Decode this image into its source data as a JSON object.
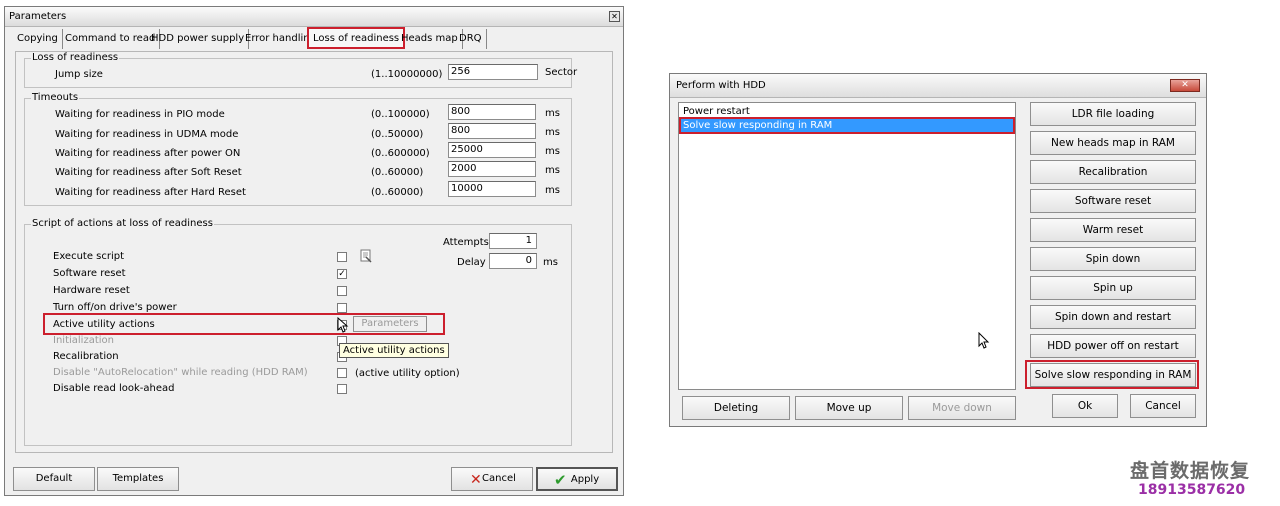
{
  "params_window": {
    "title": "Parameters",
    "tabs": [
      "Copying",
      "Command to read",
      "HDD power supply",
      "Error handling",
      "Loss of readiness",
      "Heads map",
      "DRQ"
    ],
    "active_tab": "Loss of readiness",
    "loss_group": {
      "label": "Loss of readiness",
      "jump_label": "Jump size",
      "jump_range": "(1..10000000)",
      "jump_value": "256",
      "jump_unit": "Sector"
    },
    "timeouts_group": {
      "label": "Timeouts",
      "rows": [
        {
          "label": "Waiting for readiness in PIO mode",
          "range": "(0..100000)",
          "value": "800",
          "unit": "ms"
        },
        {
          "label": "Waiting for readiness in UDMA mode",
          "range": "(0..50000)",
          "value": "800",
          "unit": "ms"
        },
        {
          "label": "Waiting for readiness after power ON",
          "range": "(0..600000)",
          "value": "25000",
          "unit": "ms"
        },
        {
          "label": "Waiting for readiness after Soft Reset",
          "range": "(0..60000)",
          "value": "2000",
          "unit": "ms"
        },
        {
          "label": "Waiting for readiness after Hard Reset",
          "range": "(0..60000)",
          "value": "10000",
          "unit": "ms"
        }
      ]
    },
    "script_group": {
      "label": "Script of actions at loss of readiness",
      "attempts_label": "Attempts",
      "attempts_value": "1",
      "delay_label": "Delay",
      "delay_value": "0",
      "delay_unit": "ms",
      "items": [
        {
          "label": "Execute script",
          "checked": ""
        },
        {
          "label": "Software reset",
          "checked": "✓"
        },
        {
          "label": "Hardware reset",
          "checked": ""
        },
        {
          "label": "Turn off/on drive's power",
          "checked": ""
        },
        {
          "label": "Active utility actions",
          "checked": ""
        },
        {
          "label": "Initialization",
          "checked": ""
        },
        {
          "label": "Recalibration",
          "checked": ""
        },
        {
          "label": "Disable \"AutoRelocation\" while reading (HDD RAM)",
          "checked": ""
        },
        {
          "label": "Disable read look-ahead",
          "checked": ""
        }
      ],
      "parameters_button": "Parameters",
      "tooltip": "Active utility actions",
      "active_option_note": "(active utility option)"
    },
    "footer": {
      "default_button": "Default",
      "templates_button": "Templates",
      "cancel_button": "Cancel",
      "apply_button": "Apply"
    }
  },
  "perform_window": {
    "title": "Perform with HDD",
    "close_glyph": "✕",
    "list_items": [
      "Power restart",
      "Solve slow responding in RAM"
    ],
    "selected_item": "Solve slow responding in RAM",
    "side_buttons": [
      "LDR file loading",
      "New heads map in RAM",
      "Recalibration",
      "Software reset",
      "Warm reset",
      "Spin down",
      "Spin up",
      "Spin down and restart",
      "HDD power off on restart",
      "Solve slow responding in RAM"
    ],
    "bottom_buttons": {
      "deleting": "Deleting",
      "move_up": "Move up",
      "move_down": "Move down",
      "ok": "Ok",
      "cancel": "Cancel"
    }
  },
  "watermark": {
    "line1": "盘首数据恢复",
    "line2": "18913587620"
  },
  "colors": {
    "highlight_red": "#cc1f2d",
    "selection_blue": "#3399ff",
    "watermark_phone": "#9b2fa6"
  }
}
